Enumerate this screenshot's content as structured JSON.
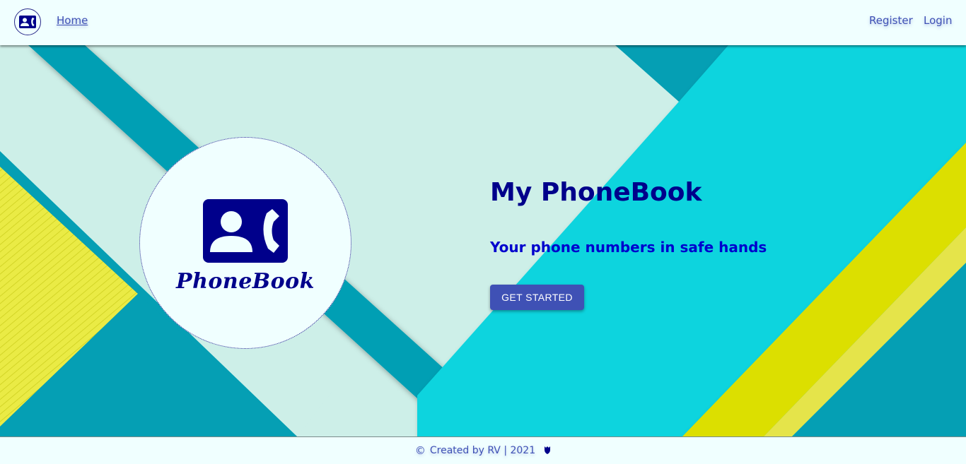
{
  "header": {
    "logo_icon": "contact-phone-icon",
    "nav_home": "Home",
    "nav_register": "Register",
    "nav_login": "Login"
  },
  "hero": {
    "logo_icon": "contact-phone-icon",
    "brand_name": "PhoneBook",
    "title": "My PhoneBook",
    "subtitle": "Your phone numbers in safe hands",
    "cta_label": "GET STARTED"
  },
  "footer": {
    "copyright_symbol": "©",
    "text": "Created by RV | 2021",
    "emblem_icon": "shield-icon"
  },
  "colors": {
    "primary": "#3f51b5",
    "navy": "#00008b",
    "teal": "#059fb4",
    "cyan": "#10d4de",
    "mint": "#cdefe8",
    "yellow": "#dcdf06",
    "background": "#f0ffff"
  }
}
